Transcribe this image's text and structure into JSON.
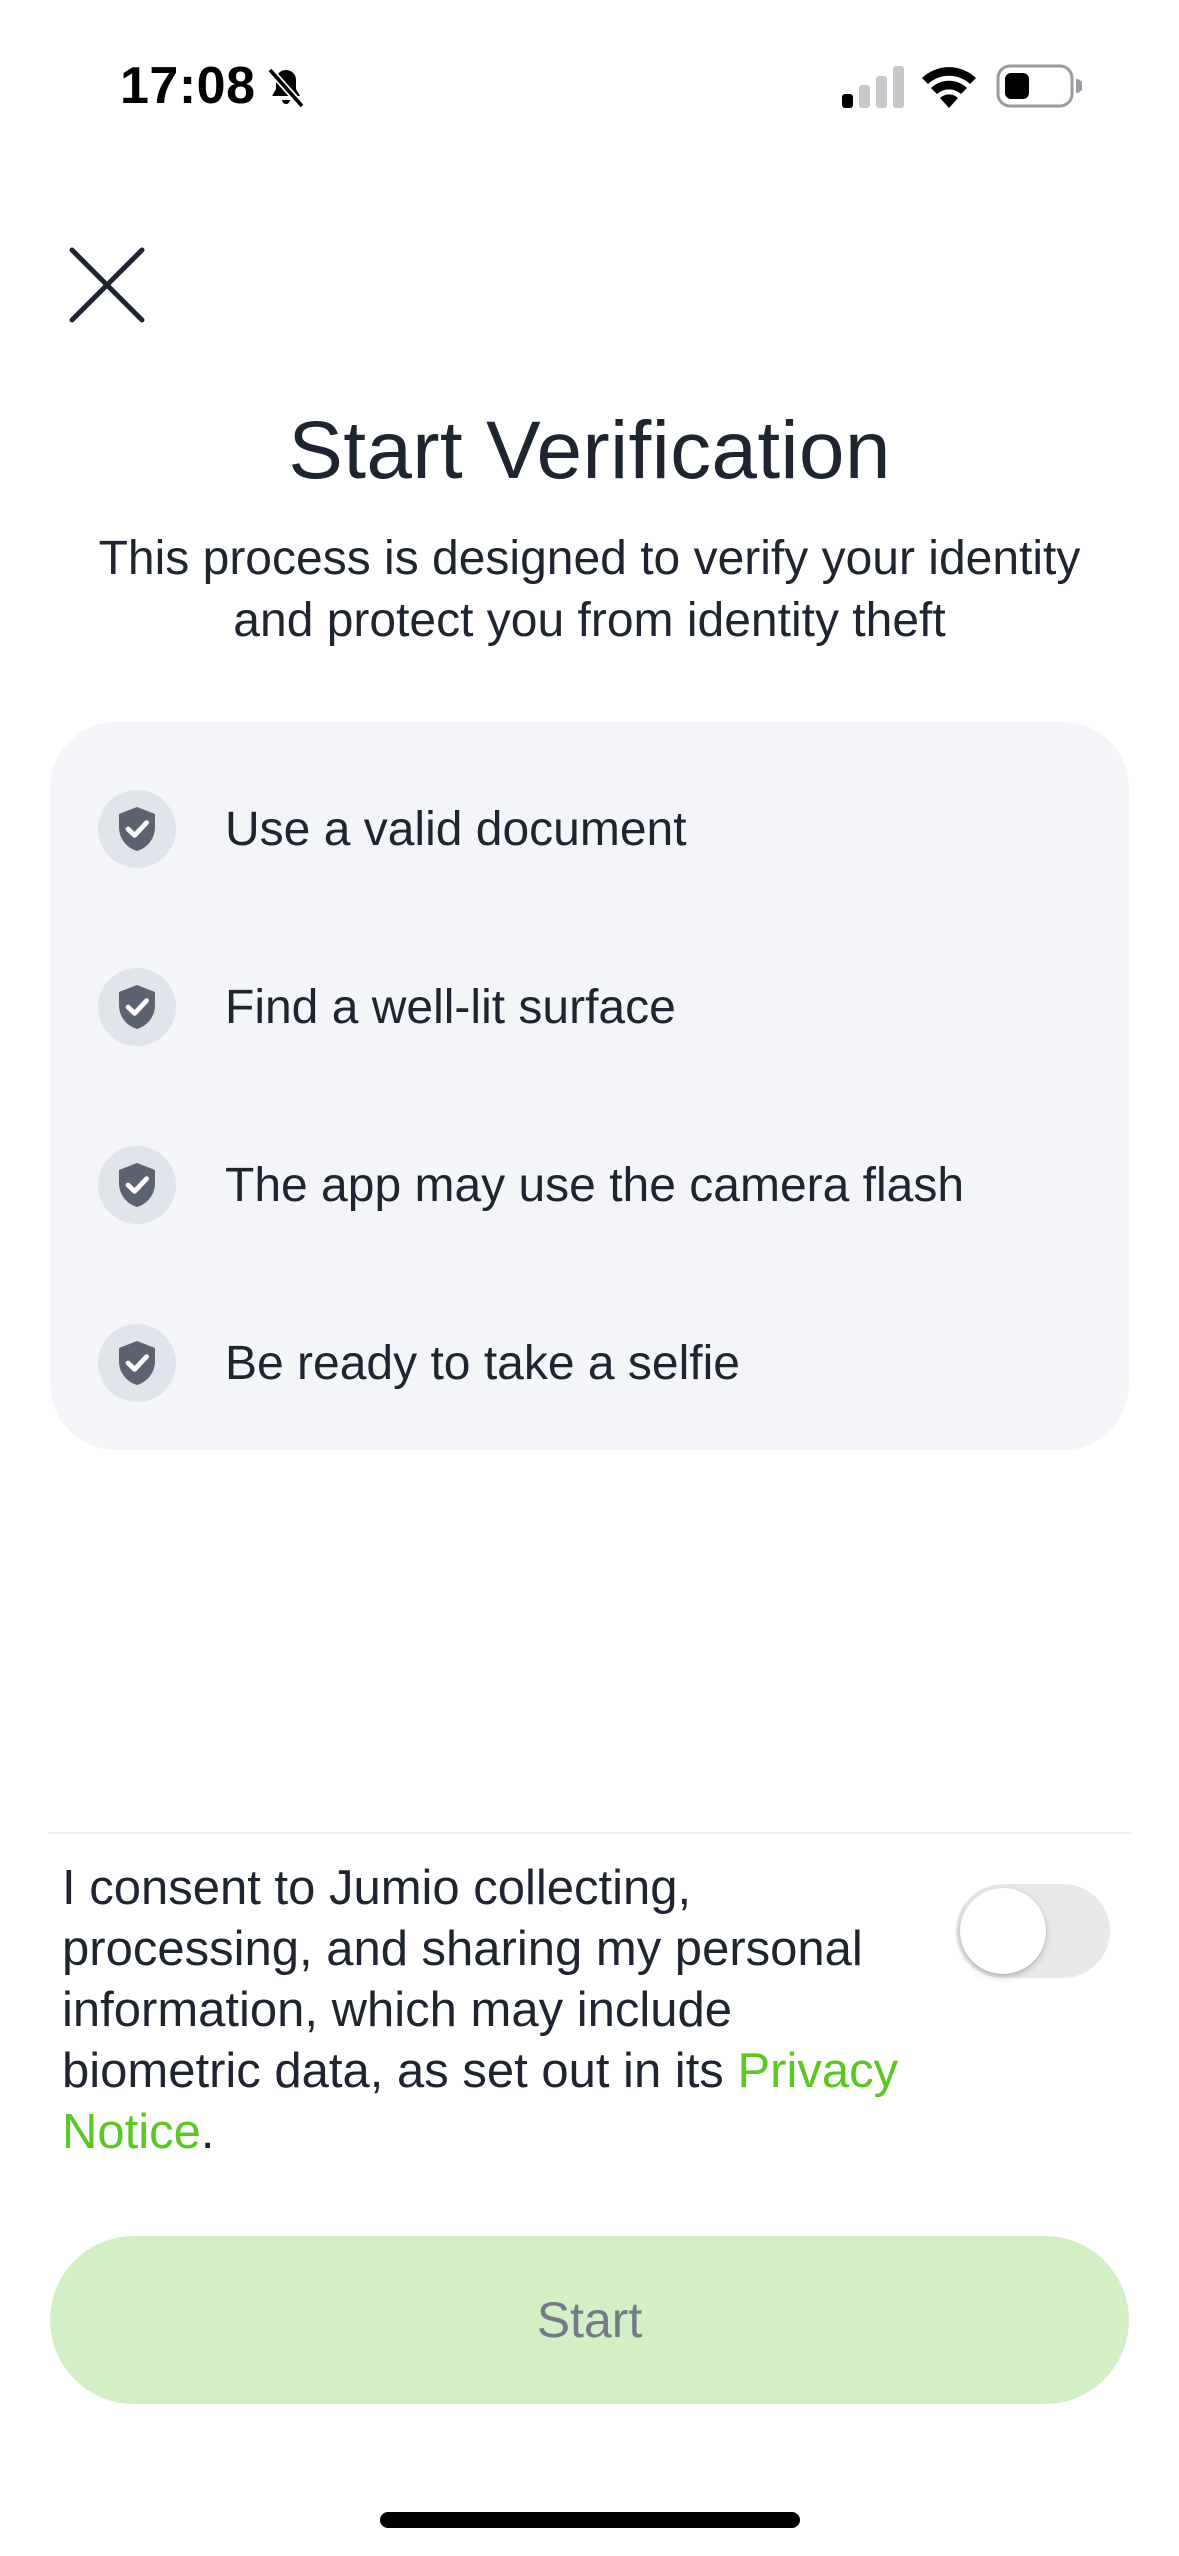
{
  "status_bar": {
    "time": "17:08",
    "icons": [
      "bell-slash-icon",
      "cellular-signal-icon",
      "wifi-icon",
      "battery-icon"
    ],
    "signal_bars_active": 1,
    "signal_bars_total": 4,
    "battery_level": 0.3
  },
  "close_icon": "close-icon",
  "title": "Start Verification",
  "subtitle": "This process is designed to verify your identity and protect you from identity theft",
  "checklist": [
    {
      "icon": "shield-check-icon",
      "label": "Use a valid document"
    },
    {
      "icon": "shield-check-icon",
      "label": "Find a well-lit surface"
    },
    {
      "icon": "shield-check-icon",
      "label": "The app may use the camera flash"
    },
    {
      "icon": "shield-check-icon",
      "label": "Be ready to take a selfie"
    }
  ],
  "consent": {
    "text": "I consent to Jumio collecting, processing, and sharing my personal information, which may include biometric data, as set out in its ",
    "link_text": "Privacy Notice",
    "suffix": ".",
    "toggle_on": false
  },
  "start_button": {
    "label": "Start",
    "enabled": false
  },
  "colors": {
    "accent": "#5ac722",
    "button_disabled_bg": "#d3efc5",
    "button_disabled_text": "#737b87",
    "card_bg": "#f4f5f8",
    "icon_color": "#5b6270",
    "text": "#1f2530"
  }
}
